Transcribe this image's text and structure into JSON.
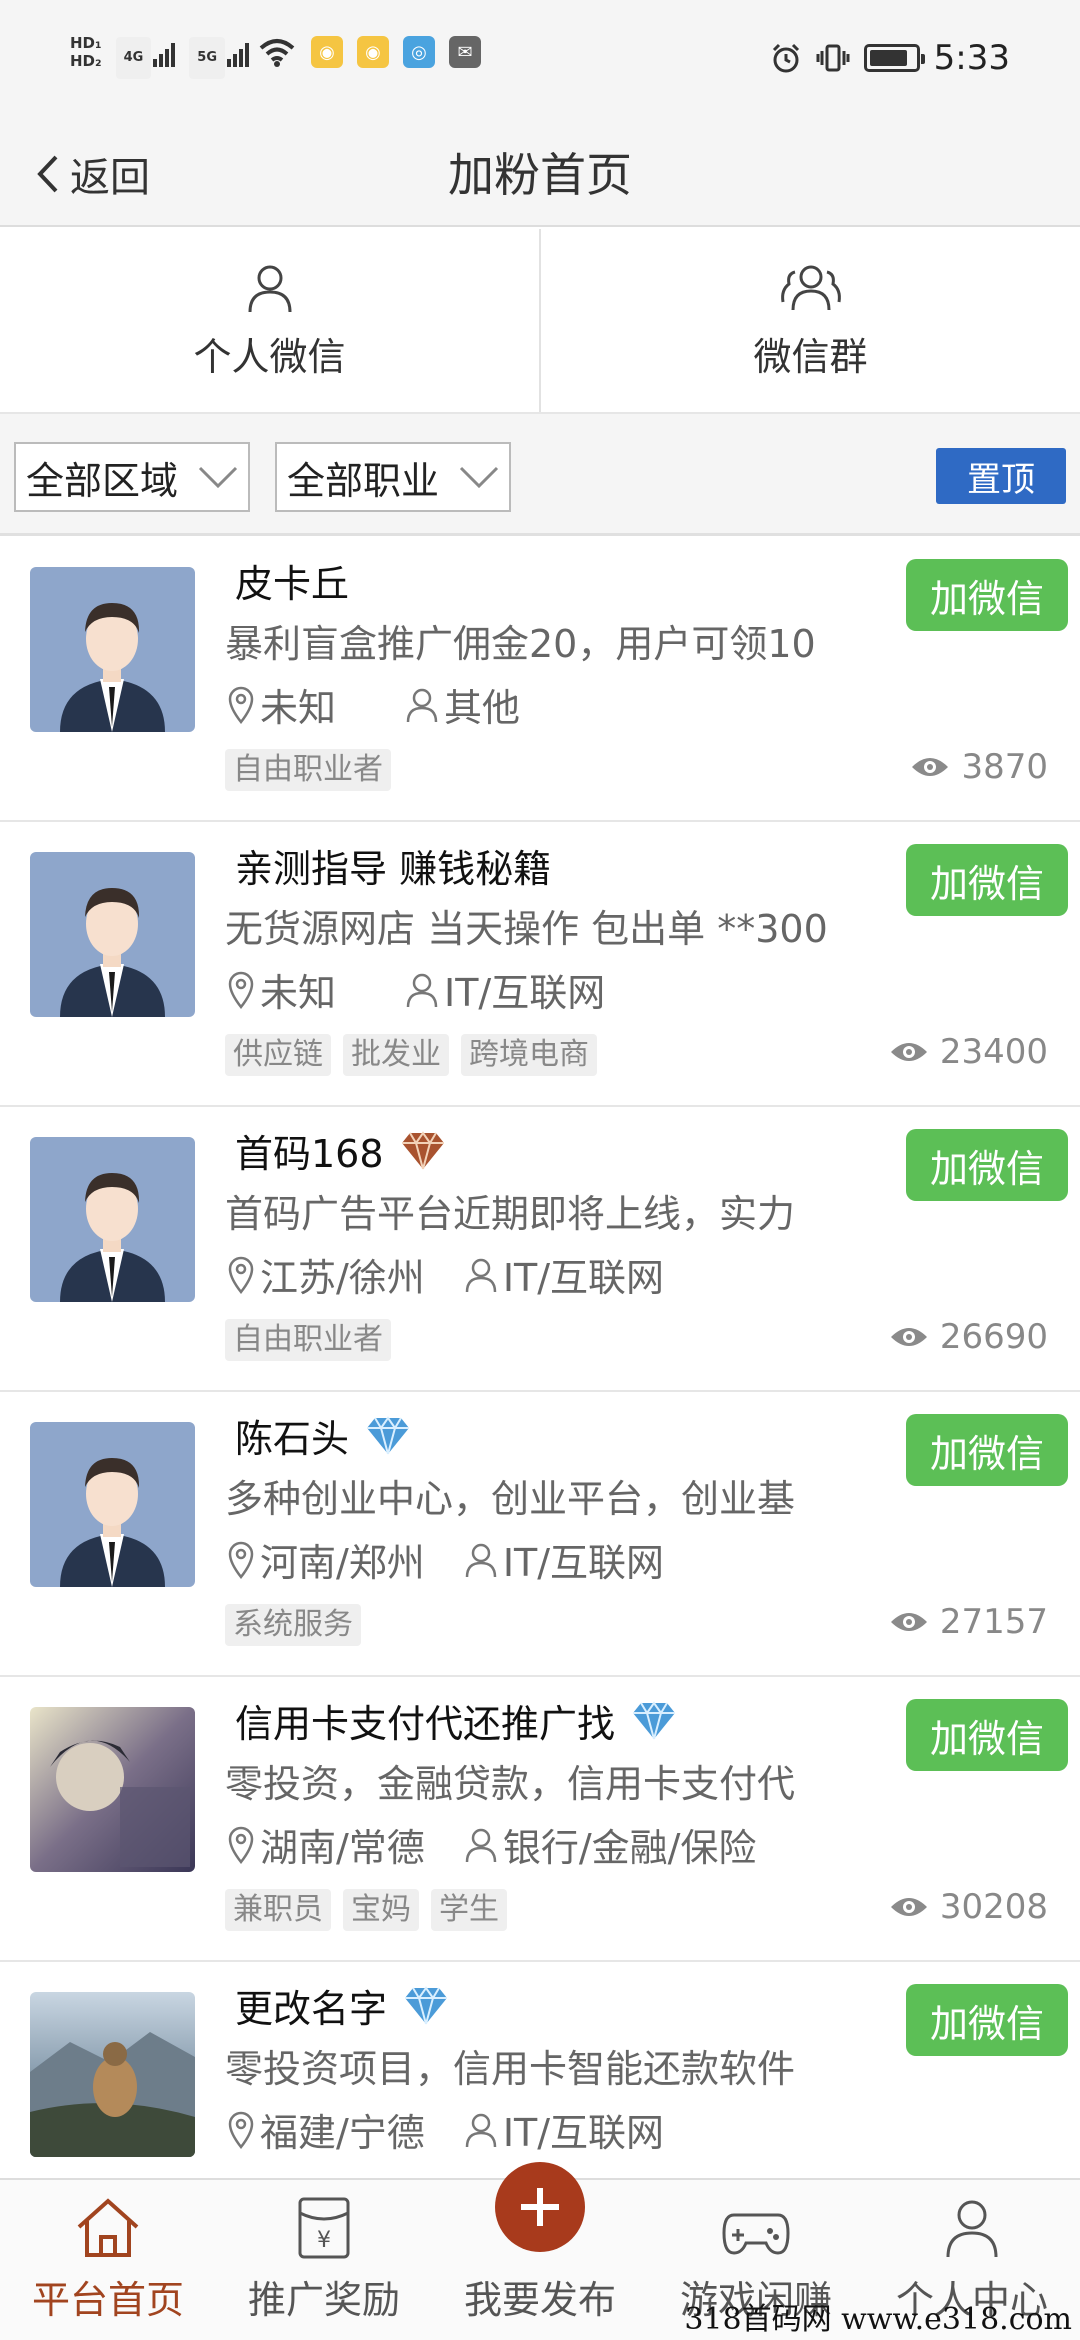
{
  "status_bar": {
    "hd1": "HD₁",
    "hd2": "HD₂",
    "net1": "4G",
    "net2": "5G",
    "time": "5:33",
    "battery_level": 0.85
  },
  "header": {
    "back_label": "返回",
    "title": "加粉首页"
  },
  "tabs": [
    {
      "label": "个人微信",
      "icon": "person-icon"
    },
    {
      "label": "微信群",
      "icon": "group-icon"
    }
  ],
  "filters": {
    "region": "全部区域",
    "occupation": "全部职业",
    "pin_label": "置顶"
  },
  "add_label": "加微信",
  "listings": [
    {
      "name": "皮卡丘",
      "badge": "",
      "desc": "暴利盲盒推广佣金20，用户可领10",
      "location": "未知",
      "job": "其他",
      "tags": [
        "自由职业者"
      ],
      "views": "3870",
      "avatar": "default"
    },
    {
      "name": "亲测指导 赚钱秘籍",
      "badge": "",
      "desc": "无货源网店 当天操作 包出单 **300",
      "location": "未知",
      "job": "IT/互联网",
      "tags": [
        "供应链",
        "批发业",
        "跨境电商"
      ],
      "views": "23400",
      "avatar": "default"
    },
    {
      "name": "首码168",
      "badge": "bronze",
      "desc": "首码广告平台近期即将上线，实力",
      "location": "江苏/徐州",
      "job": "IT/互联网",
      "tags": [
        "自由职业者"
      ],
      "views": "26690",
      "avatar": "default"
    },
    {
      "name": "陈石头",
      "badge": "blue",
      "desc": "多种创业中心，创业平台，创业基",
      "location": "河南/郑州",
      "job": "IT/互联网",
      "tags": [
        "系统服务"
      ],
      "views": "27157",
      "avatar": "default"
    },
    {
      "name": "信用卡支付代还推广找",
      "badge": "blue",
      "desc": "零投资，金融贷款，信用卡支付代",
      "location": "湖南/常德",
      "job": "银行/金融/保险",
      "tags": [
        "兼职员",
        "宝妈",
        "学生"
      ],
      "views": "30208",
      "avatar": "photo1"
    },
    {
      "name": "更改名字",
      "badge": "blue",
      "desc": "零投资项目，信用卡智能还款软件",
      "location": "福建/宁德",
      "job": "IT/互联网",
      "tags": [],
      "views": "",
      "avatar": "photo2"
    }
  ],
  "bottom_nav": [
    {
      "label": "平台首页",
      "icon": "home-icon",
      "active": true
    },
    {
      "label": "推广奖励",
      "icon": "reward-icon",
      "active": false
    },
    {
      "label": "我要发布",
      "icon": "plus-icon",
      "active": false
    },
    {
      "label": "游戏闲赚",
      "icon": "gamepad-icon",
      "active": false
    },
    {
      "label": "个人中心",
      "icon": "person-icon",
      "active": false
    }
  ],
  "watermark": "318首码网 www.e318.com"
}
